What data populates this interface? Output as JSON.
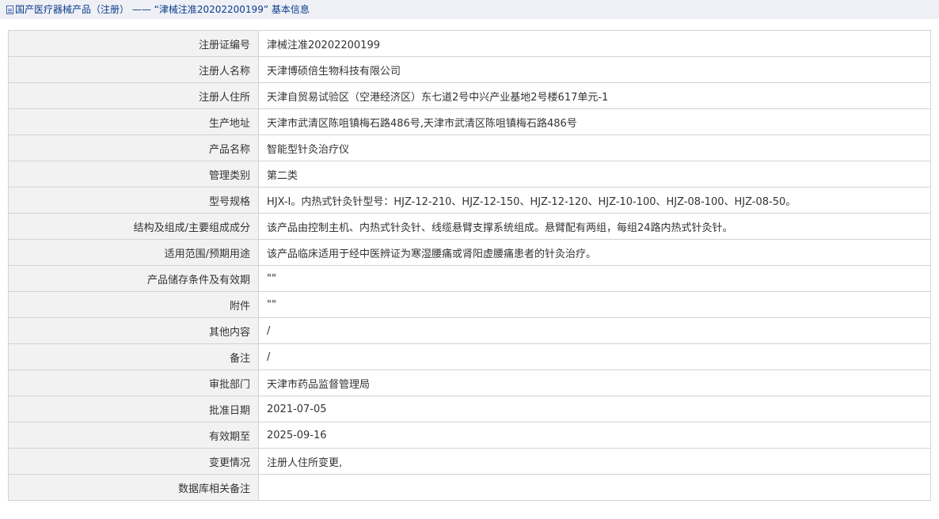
{
  "breadcrumb": {
    "text": "国产医疗器械产品（注册） ——  “津械注准20202200199”  基本信息"
  },
  "rows": [
    {
      "label": "注册证编号",
      "value": "津械注准20202200199"
    },
    {
      "label": "注册人名称",
      "value": "天津博硕倍生物科技有限公司"
    },
    {
      "label": "注册人住所",
      "value": "天津自贸易试验区（空港经济区）东七道2号中兴产业基地2号楼617单元-1"
    },
    {
      "label": "生产地址",
      "value": "天津市武清区陈咀镇梅石路486号,天津市武清区陈咀镇梅石路486号"
    },
    {
      "label": "产品名称",
      "value": "智能型针灸治疗仪"
    },
    {
      "label": "管理类别",
      "value": "第二类"
    },
    {
      "label": "型号规格",
      "value": "HJX-I。内热式针灸针型号：HJZ-12-210、HJZ-12-150、HJZ-12-120、HJZ-10-100、HJZ-08-100、HJZ-08-50。"
    },
    {
      "label": "结构及组成/主要组成成分",
      "value": "该产品由控制主机、内热式针灸针、线缆悬臂支撑系统组成。悬臂配有两组，每组24路内热式针灸针。"
    },
    {
      "label": "适用范围/预期用途",
      "value": "该产品临床适用于经中医辨证为寒湿腰痛或肾阳虚腰痛患者的针灸治疗。"
    },
    {
      "label": "产品储存条件及有效期",
      "value": "\"\""
    },
    {
      "label": "附件",
      "value": "\"\""
    },
    {
      "label": "其他内容",
      "value": "/"
    },
    {
      "label": "备注",
      "value": "/"
    },
    {
      "label": "审批部门",
      "value": "天津市药品监督管理局"
    },
    {
      "label": "批准日期",
      "value": "2021-07-05"
    },
    {
      "label": "有效期至",
      "value": "2025-09-16"
    },
    {
      "label": "变更情况",
      "value": "注册人住所变更,"
    },
    {
      "label": "数据库相关备注",
      "value": ""
    }
  ]
}
